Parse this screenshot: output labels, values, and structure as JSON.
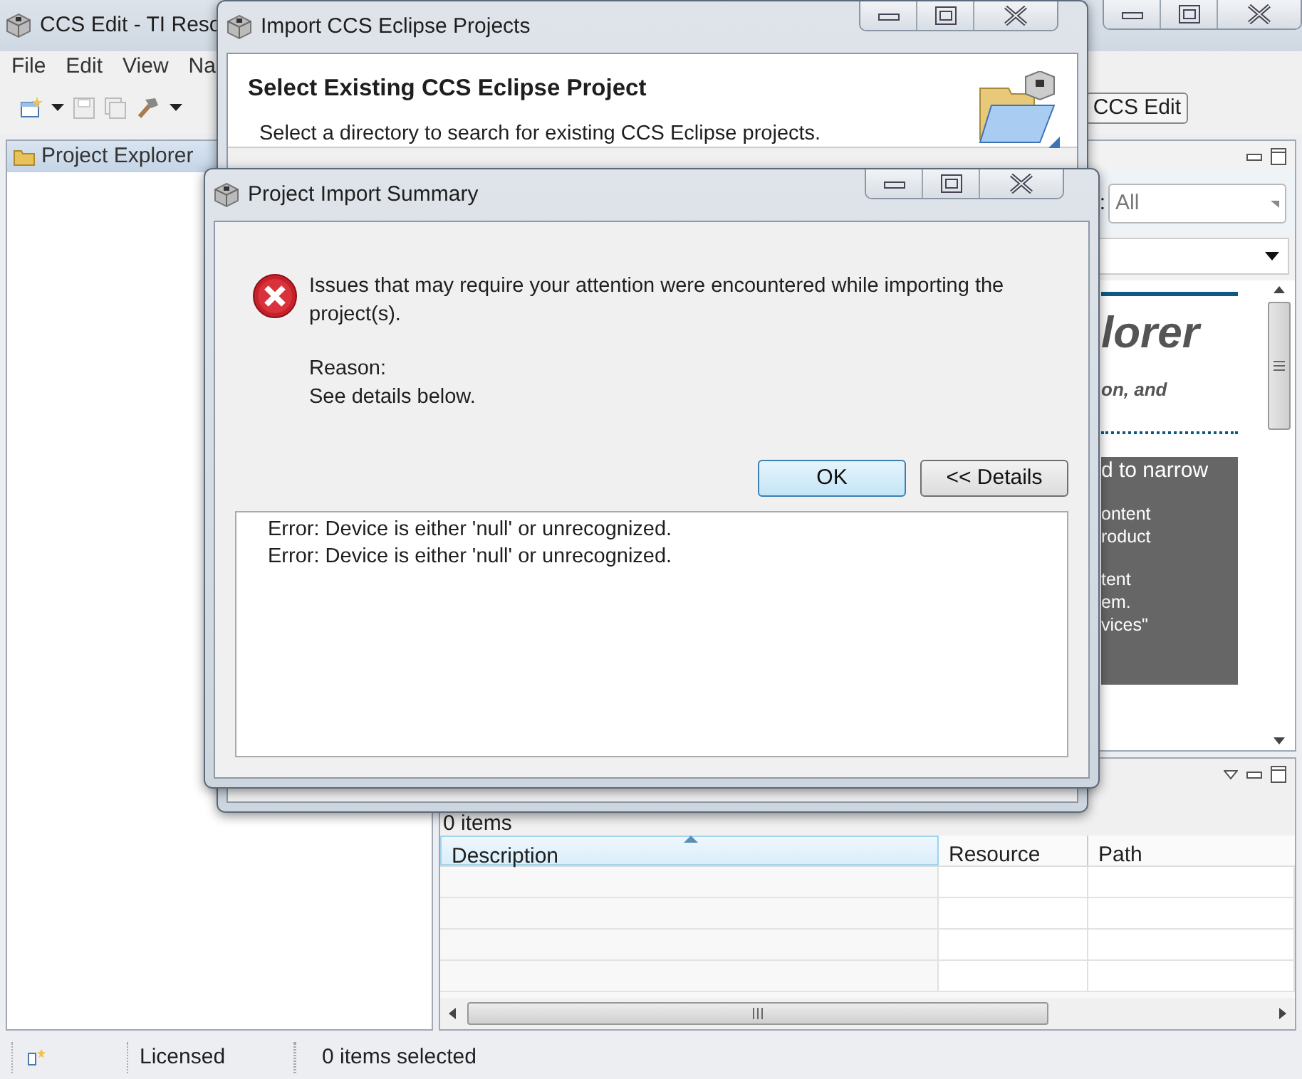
{
  "main_window": {
    "title": "CCS Edit - TI Reso",
    "menu": [
      "File",
      "Edit",
      "View",
      "Na"
    ],
    "perspective_button": "CCS Edit",
    "project_explorer": {
      "tab": "Project Explorer"
    },
    "filter": {
      "label": ":",
      "value": "All"
    },
    "welcome_page": {
      "heading": "lorer",
      "subtitle": "on, and",
      "box_paragraphs": [
        [
          "d to narrow"
        ],
        [
          "ontent",
          "roduct"
        ],
        [
          "tent",
          "em.",
          "vices\""
        ]
      ]
    },
    "problems": {
      "count": "0 items",
      "columns": [
        {
          "label": "Description",
          "sorted": true
        },
        {
          "label": "Resource",
          "sorted": false
        },
        {
          "label": "Path",
          "sorted": false
        }
      ]
    },
    "status_bar": [
      "Licensed",
      "0 items selected"
    ]
  },
  "import_dialog": {
    "title": "Import CCS Eclipse Projects",
    "heading": "Select Existing CCS Eclipse Project",
    "description": "Select a directory to search for existing CCS Eclipse projects."
  },
  "summary_dialog": {
    "title": "Project Import Summary",
    "message": "Issues that may require your attention were encountered while importing the project(s).",
    "reason_label": "Reason:",
    "reason": "See details below.",
    "buttons": [
      {
        "label": "OK",
        "default": true
      },
      {
        "label": "<< Details",
        "default": false
      }
    ],
    "details": [
      "Error: Device is either 'null' or unrecognized.",
      "Error: Device is either 'null' or unrecognized."
    ]
  }
}
